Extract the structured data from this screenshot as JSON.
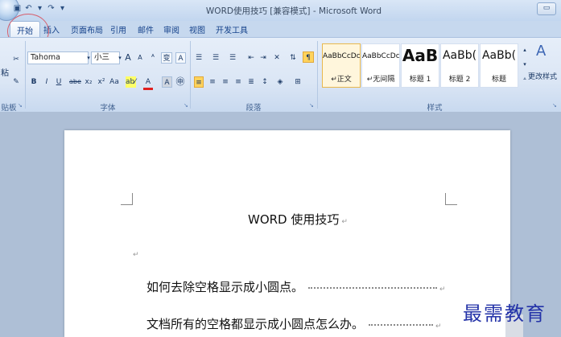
{
  "window": {
    "title": "WORD使用技巧 [兼容模式] - Microsoft Word",
    "qat": [
      "▾",
      "↶",
      "▾",
      "↷",
      "▾"
    ],
    "minimize": "▭"
  },
  "tabs": [
    "开始",
    "插入",
    "页面布局",
    "引用",
    "邮件",
    "审阅",
    "视图",
    "开发工具"
  ],
  "ribbon": {
    "clipboard": {
      "paste_label": "粘",
      "group_label": "贴板"
    },
    "font": {
      "font_name": "Tahoma",
      "font_size": "小三",
      "grow": "A",
      "shrink": "A",
      "clear": "ᴬ",
      "phonetic": "变",
      "char_border": "A",
      "bold": "B",
      "italic": "I",
      "underline": "U",
      "strike": "abe",
      "subscript": "x₂",
      "superscript": "x²",
      "case": "Aa",
      "highlight": "ab⁄",
      "font_color": "A",
      "char_shading": "A",
      "enclose": "㊥",
      "group_label": "字体"
    },
    "paragraph": {
      "group_label": "段落"
    },
    "styles": {
      "items": [
        {
          "sample": "AaBbCcDc",
          "name": "↵正文",
          "selected": true
        },
        {
          "sample": "AaBbCcDc",
          "name": "↵无间隔",
          "selected": false
        },
        {
          "sample": "AaB",
          "name": "标题 1",
          "selected": false
        },
        {
          "sample": "AaBb(",
          "name": "标题 2",
          "selected": false
        },
        {
          "sample": "AaBb(",
          "name": "标题",
          "selected": false
        }
      ],
      "change_styles": "更改样式",
      "group_label": "样式"
    }
  },
  "document": {
    "title": "WORD 使用技巧",
    "lines": [
      "如何去除空格显示成小圆点。",
      "文档所有的空格都显示成小圆点怎么办。"
    ],
    "para_mark": "↵"
  },
  "watermark": "最需教育"
}
